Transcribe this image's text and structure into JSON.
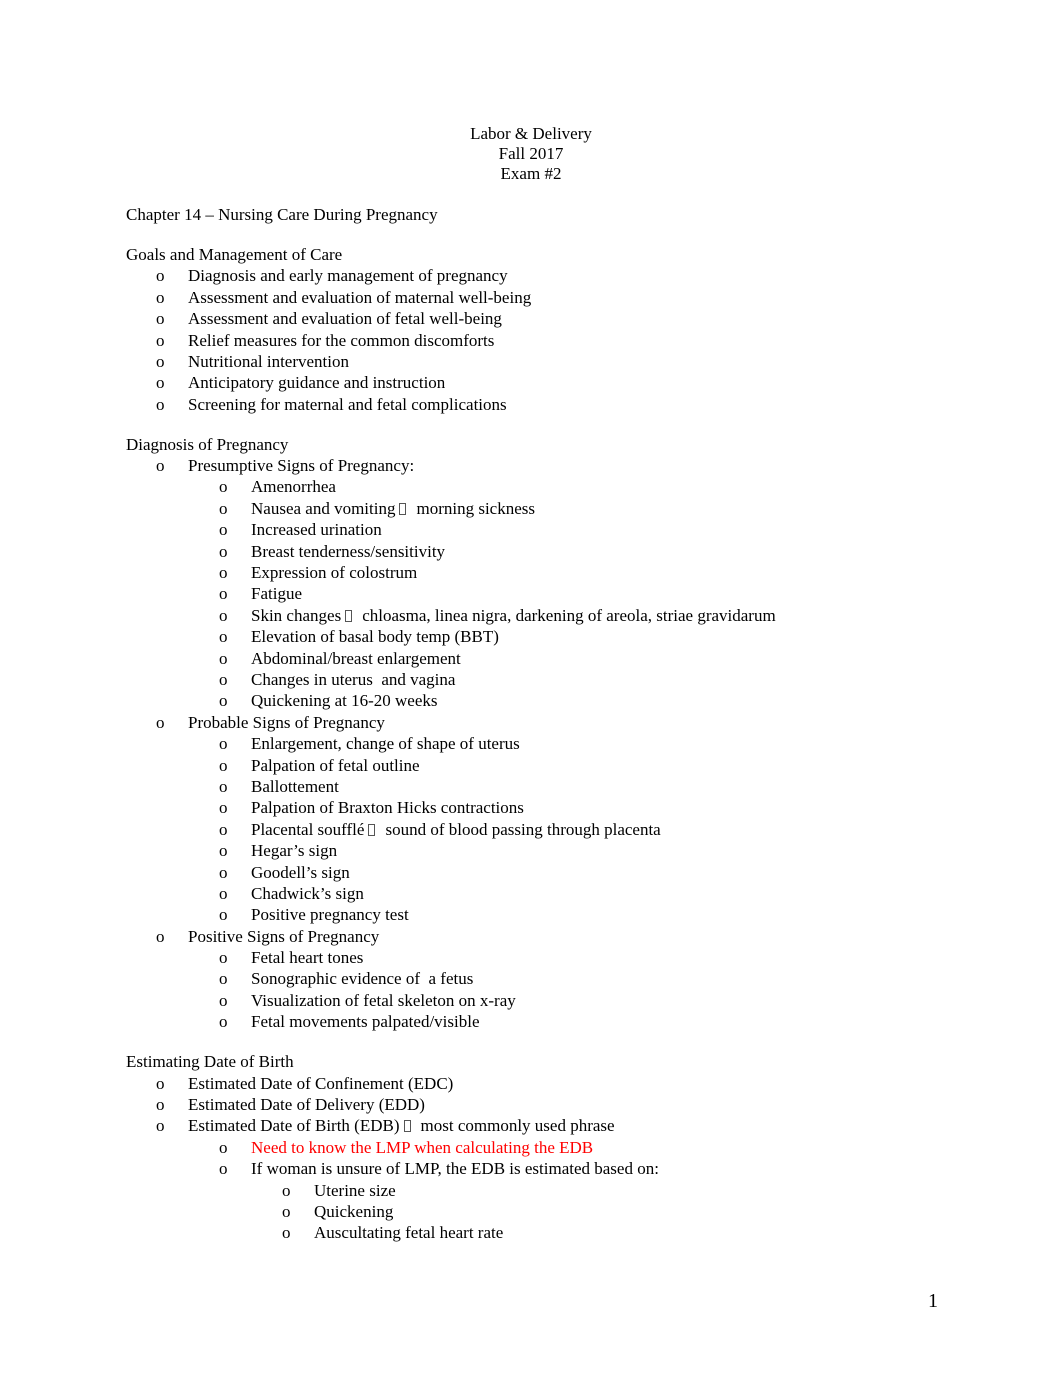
{
  "header": {
    "title": "Labor & Delivery",
    "term": "Fall 2017",
    "exam": "Exam #2"
  },
  "chapter": "Chapter 14 – Nursing Care During Pregnancy",
  "bullet_glyph": "o",
  "sections": {
    "goals": {
      "heading": "Goals and Management of Care",
      "items": [
        "Diagnosis and early management of pregnancy",
        "Assessment and evaluation of maternal well-being",
        "Assessment and evaluation of fetal well-being",
        "Relief measures for the common discomforts",
        "Nutritional intervention",
        "Anticipatory guidance and instruction",
        "Screening for maternal and fetal complications"
      ]
    },
    "diagnosis": {
      "heading": "Diagnosis of Pregnancy",
      "presumptive": {
        "label": "Presumptive Signs of Pregnancy:",
        "items": [
          {
            "text": "Amenorrhea"
          },
          {
            "text": "Nausea and vomiting",
            "arrow_icon": "arrow-right-icon",
            "detail": "morning sickness"
          },
          {
            "text": "Increased urination"
          },
          {
            "text": "Breast tenderness/sensitivity"
          },
          {
            "text": "Expression of colostrum"
          },
          {
            "text": "Fatigue"
          },
          {
            "text": "Skin changes",
            "arrow_icon": "arrow-right-icon",
            "detail": "chloasma, linea nigra, darkening of areola, striae gravidarum"
          },
          {
            "text": "Elevation of basal body temp (BBT)"
          },
          {
            "text": "Abdominal/breast enlargement"
          },
          {
            "text": "Changes in uterus  and vagina"
          },
          {
            "text": "Quickening at 16-20 weeks"
          }
        ]
      },
      "probable": {
        "label": "Probable Signs of Pregnancy",
        "items": [
          {
            "text": "Enlargement, change of shape of uterus"
          },
          {
            "text": "Palpation of fetal outline"
          },
          {
            "text": "Ballottement"
          },
          {
            "text": "Palpation of Braxton Hicks contractions"
          },
          {
            "text": "Placental soufflé",
            "arrow_icon": "arrow-right-icon",
            "detail": "sound of blood passing through placenta"
          },
          {
            "text": "Hegar’s sign"
          },
          {
            "text": "Goodell’s sign"
          },
          {
            "text": "Chadwick’s sign"
          },
          {
            "text": "Positive pregnancy test"
          }
        ]
      },
      "positive": {
        "label": "Positive Signs of Pregnancy",
        "items": [
          {
            "text": "Fetal heart tones"
          },
          {
            "text": "Sonographic evidence of  a fetus"
          },
          {
            "text": "Visualization of fetal skeleton on x-ray"
          },
          {
            "text": "Fetal movements palpated/visible"
          }
        ]
      }
    },
    "edb": {
      "heading": "Estimating Date of Birth",
      "items": [
        {
          "text": "Estimated Date of Confinement (EDC)"
        },
        {
          "text": "Estimated Date of Delivery (EDD)"
        },
        {
          "text": "Estimated Date of Birth (EDB)",
          "arrow_icon": "arrow-right-icon",
          "detail": "most commonly used phrase"
        }
      ],
      "edb_sub": [
        {
          "text": "Need to know the LMP when calculating the EDB",
          "color": "#ff0000"
        },
        {
          "text": "If woman is unsure of LMP, the EDB is estimated based on:"
        }
      ],
      "unsure_items": [
        "Uterine size",
        "Quickening",
        "Auscultating fetal heart rate"
      ]
    }
  },
  "page_number": "1"
}
